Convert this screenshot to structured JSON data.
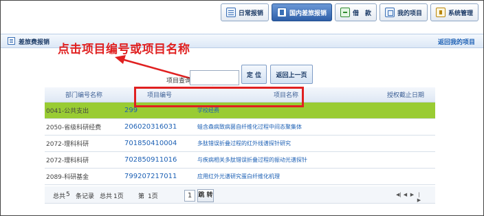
{
  "nav": {
    "items": [
      {
        "label": "日常报销",
        "icon": "document-list-icon",
        "active": false
      },
      {
        "label": "国内差旅报销",
        "icon": "travel-doc-icon",
        "active": true
      },
      {
        "label": "借　款",
        "icon": "loan-icon",
        "active": false
      },
      {
        "label": "我的项目",
        "icon": "project-icon",
        "active": false
      },
      {
        "label": "系统管理",
        "icon": "settings-icon",
        "active": false
      }
    ]
  },
  "section": {
    "title": "差旅费报销",
    "back_link": "返回我的项目"
  },
  "annotation": {
    "text": "点击项目编号或项目名称",
    "color": "#e02020"
  },
  "search": {
    "label": "项目查询：",
    "value": "",
    "locate_label": "定 位",
    "back_label": "返回上一页"
  },
  "table": {
    "headers": [
      "部门编号名称",
      "项目编号",
      "项目名称",
      "授权截止日期"
    ],
    "rows": [
      {
        "dept": "0041-公共支出",
        "code": "299",
        "name": "学校经费",
        "date": "",
        "highlight": true
      },
      {
        "dept": "2050-省级科研经费",
        "code": "206020316031",
        "name": "蛙含森病致病菌自纤维化过程中间态聚集体",
        "date": "",
        "highlight": false
      },
      {
        "dept": "2072-理科科研",
        "code": "701850410004",
        "name": "多肽错误折叠过程的红外线谱探针研究",
        "date": "",
        "highlight": false
      },
      {
        "dept": "2072-理科科研",
        "code": "702850911016",
        "name": "与疾病相关多肽错误折叠过程的振动光谱探针",
        "date": "",
        "highlight": false
      },
      {
        "dept": "2089-科研基金",
        "code": "799207217011",
        "name": "应用红外光谱研究蛋白纤维化机理",
        "date": "",
        "highlight": false
      }
    ],
    "highlight_color": "#99cc33"
  },
  "footer": {
    "total_label": "总共",
    "total_records": "5",
    "records_label": "条记录",
    "total_pages_label": "总共",
    "total_pages": "1页",
    "current_label": "第",
    "current_page": "1页",
    "page_input": "1",
    "jump_label": "跳 转"
  }
}
